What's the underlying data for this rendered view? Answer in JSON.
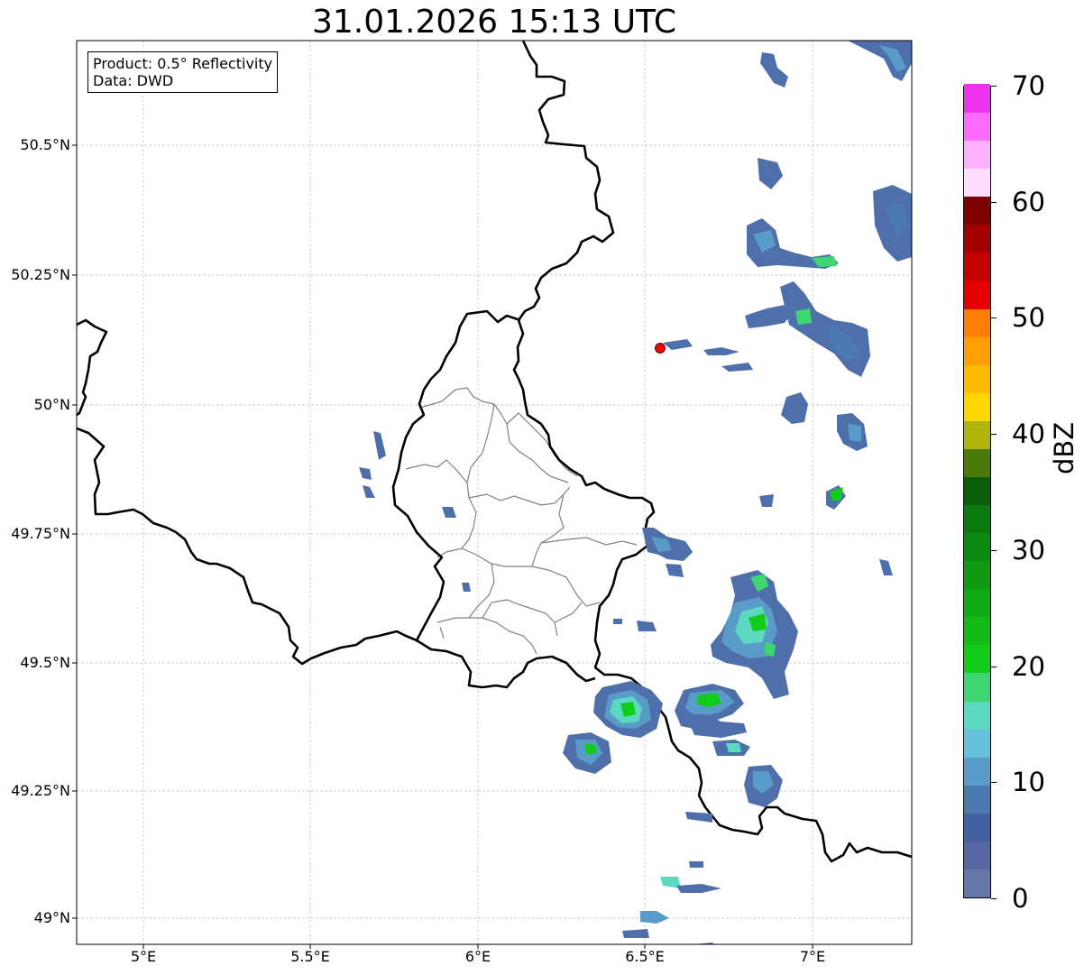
{
  "title": "31.01.2026 15:13 UTC",
  "info_box": {
    "product": "Product: 0.5° Reflectivity",
    "data": "Data: DWD"
  },
  "axes": {
    "lat_labels": [
      "50.5°N",
      "50.25°N",
      "50°N",
      "49.75°N",
      "49.5°N",
      "49.25°N",
      "49°N"
    ],
    "lon_labels": [
      "5°E",
      "5.5°E",
      "6°E",
      "6.5°E",
      "7°E"
    ],
    "gridlines": true
  },
  "radar_site_marker": {
    "lon": 6.55,
    "lat": 50.11,
    "color": "#ff0000"
  },
  "colorbar": {
    "label": "dBZ",
    "ticks": [
      "0",
      "10",
      "20",
      "30",
      "40",
      "50",
      "60",
      "70"
    ],
    "min": 0,
    "max": 70,
    "colors": [
      "#6677aa",
      "#5568a3",
      "#4460a4",
      "#4b7ab0",
      "#5a9cc9",
      "#66c1dd",
      "#5dd8c1",
      "#3dd672",
      "#12cc1a",
      "#12bb16",
      "#10ab14",
      "#0f9a12",
      "#0c8a10",
      "#0a7a0d",
      "#085f0a",
      "#4a7a0a",
      "#b0b40a",
      "#ffd700",
      "#ffbb00",
      "#ff9f00",
      "#ff7f00",
      "#e60000",
      "#c40000",
      "#a40000",
      "#7f0000",
      "#ffddff",
      "#ffb0ff",
      "#ff6dff",
      "#ee33ee"
    ]
  }
}
